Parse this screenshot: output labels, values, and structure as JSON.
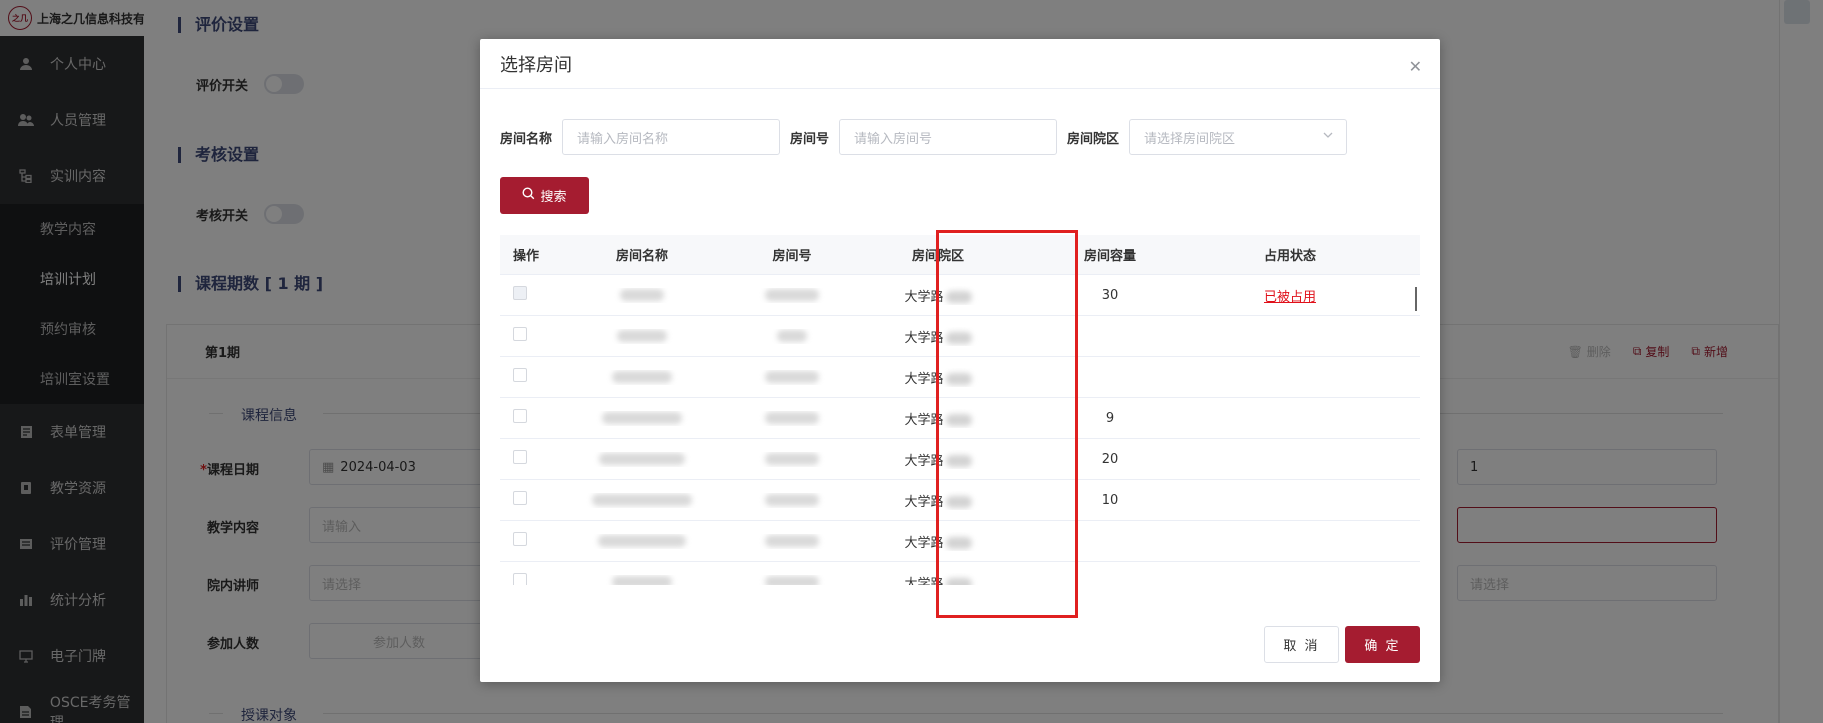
{
  "app": {
    "logo_text": "之几",
    "title": "上海之几信息科技有"
  },
  "sidebar": {
    "items": [
      {
        "label": "个人中心",
        "icon": "user-icon"
      },
      {
        "label": "人员管理",
        "icon": "users-icon"
      },
      {
        "label": "实训内容",
        "icon": "tree-icon"
      },
      {
        "label": "表单管理",
        "icon": "form-icon"
      },
      {
        "label": "教学资源",
        "icon": "resource-icon"
      },
      {
        "label": "评价管理",
        "icon": "evaluate-icon"
      },
      {
        "label": "统计分析",
        "icon": "bar-chart-icon"
      },
      {
        "label": "电子门牌",
        "icon": "monitor-icon"
      },
      {
        "label": "OSCE考务管理",
        "icon": "doc-icon"
      }
    ],
    "sub_items": [
      "教学内容",
      "培训计划",
      "预约审核",
      "培训室设置"
    ]
  },
  "page": {
    "eval_section": "评价设置",
    "eval_switch_label": "评价开关",
    "exam_section": "考核设置",
    "exam_switch_label": "考核开关",
    "course_section": "课程期数 [ 1 期 ]",
    "period_label": "第1期",
    "actions": {
      "delete": "删除",
      "copy": "复制",
      "add": "新增"
    },
    "course_info": "课程信息",
    "date_label": "课程日期",
    "date_value": "2024-04-03",
    "right_value": "1",
    "content_label": "教学内容",
    "content_placeholder": "请输入",
    "teacher_label": "院内讲师",
    "teacher_placeholder": "请选择",
    "right_select_placeholder": "请选择",
    "count_label": "参加人数",
    "count_placeholder": "参加人数",
    "target_label": "授课对象"
  },
  "dialog": {
    "title": "选择房间",
    "filters": {
      "name_label": "房间名称",
      "name_placeholder": "请输入房间名称",
      "number_label": "房间号",
      "number_placeholder": "请输入房间号",
      "campus_label": "房间院区",
      "campus_placeholder": "请选择房间院区"
    },
    "search_label": "搜索",
    "columns": [
      "操作",
      "房间名称",
      "房间号",
      "房间院区",
      "房间容量",
      "占用状态"
    ],
    "rows": [
      {
        "campus": "大学路",
        "capacity": "30",
        "status": "已被占用",
        "disabled": true
      },
      {
        "campus": "大学路",
        "capacity": "",
        "status": "",
        "disabled": false
      },
      {
        "campus": "大学路",
        "capacity": "",
        "status": "",
        "disabled": false
      },
      {
        "campus": "大学路",
        "capacity": "9",
        "status": "",
        "disabled": false
      },
      {
        "campus": "大学路",
        "capacity": "20",
        "status": "",
        "disabled": false
      },
      {
        "campus": "大学路",
        "capacity": "10",
        "status": "",
        "disabled": false
      },
      {
        "campus": "大学路",
        "capacity": "",
        "status": "",
        "disabled": false
      },
      {
        "campus": "大学路",
        "capacity": "",
        "status": "",
        "disabled": false
      }
    ],
    "cancel_label": "取 消",
    "confirm_label": "确 定"
  },
  "colors": {
    "brand": "#a51c30",
    "highlight": "#e02020",
    "link_red": "#e0101a"
  }
}
